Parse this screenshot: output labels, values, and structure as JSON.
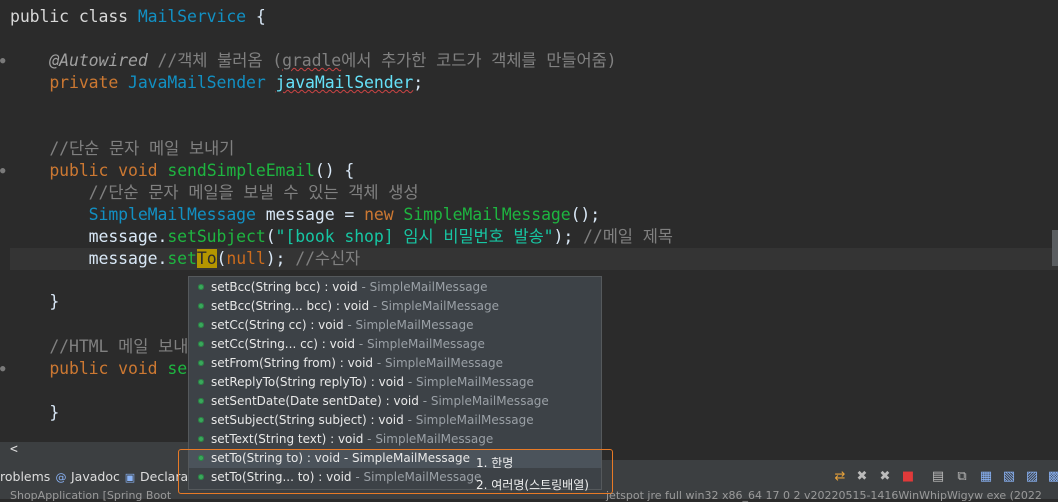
{
  "code": {
    "line1": {
      "kw": "public class ",
      "cls": "MailService",
      "rest": " {"
    },
    "line2": {
      "ann": "@Autowired",
      "cmt": " //객체 불러옴 (",
      "sq": "gradle",
      "cmt2": "에서 추가한 코드가 객체를 만들어줌)"
    },
    "line3": {
      "kw": "private ",
      "cls": "JavaMailSender",
      "sp": " ",
      "fld": "javaMailSender",
      "rest": ";"
    },
    "line4": {
      "cmt": "//단순 문자 메일 보내기"
    },
    "line5": {
      "kw": "public void ",
      "mth": "sendSimpleEmail",
      "rest": "() {"
    },
    "line6": {
      "cmt": "//단순 문자 메일을 보낼 수 있는 객체 생성"
    },
    "line7": {
      "cls": "SimpleMailMessage",
      "sp": " ",
      "plain": "message",
      "op": " = ",
      "kw": "new ",
      "mth": "SimpleMailMessage",
      "rest": "();"
    },
    "line8": {
      "plain": "message.",
      "mth": "setSubject",
      "p1": "(",
      "str": "\"[book shop] 임시 비밀번호 발송\"",
      "p2": "); ",
      "cmt": "//메일 제목"
    },
    "line9": {
      "plain": "message.",
      "mth": "set",
      "hl": "To",
      "p1": "(",
      "nul": "null",
      "p2": "); ",
      "cmt": "//수신자"
    },
    "line10": {
      "rest": "}"
    },
    "line11": {
      "cmt": "//HTML 메일 보내"
    },
    "line12": {
      "kw": "public void ",
      "mth": "send"
    },
    "line13": {
      "rest": "}"
    }
  },
  "hscroll_glyph": "<",
  "autocomplete": {
    "items": [
      {
        "sig": "setBcc(String bcc) : void",
        "src": " - SimpleMailMessage"
      },
      {
        "sig": "setBcc(String... bcc) : void",
        "src": " - SimpleMailMessage"
      },
      {
        "sig": "setCc(String cc) : void",
        "src": " - SimpleMailMessage"
      },
      {
        "sig": "setCc(String... cc) : void",
        "src": " - SimpleMailMessage"
      },
      {
        "sig": "setFrom(String from) : void",
        "src": " - SimpleMailMessage"
      },
      {
        "sig": "setReplyTo(String replyTo) : void",
        "src": " - SimpleMailMessage"
      },
      {
        "sig": "setSentDate(Date sentDate) : void",
        "src": " - SimpleMailMessage"
      },
      {
        "sig": "setSubject(String subject) : void",
        "src": " - SimpleMailMessage"
      },
      {
        "sig": "setText(String text) : void",
        "src": " - SimpleMailMessage"
      },
      {
        "sig": "setTo(String to) : void",
        "src": " - SimpleMailMessage"
      },
      {
        "sig": "setTo(String... to) : void",
        "src": " - SimpleMailMessage"
      }
    ]
  },
  "notes": {
    "one": "1. 한명",
    "two": "2. 여러명(스트링배열)"
  },
  "panel": {
    "tab_problems": "roblems",
    "tab_javadoc": "Javadoc",
    "tab_declaration": "Declarati",
    "status_left": "ShopApplication [Spring Boot",
    "status_right": "jetspot jre full win32 x86_64 17 0 2 v20220515-1416WinWhipWigyw exe (2022"
  },
  "colors": {
    "accent_callout": "#e87a26",
    "selection": "#4b535b",
    "method_dot": "#39a85b"
  }
}
